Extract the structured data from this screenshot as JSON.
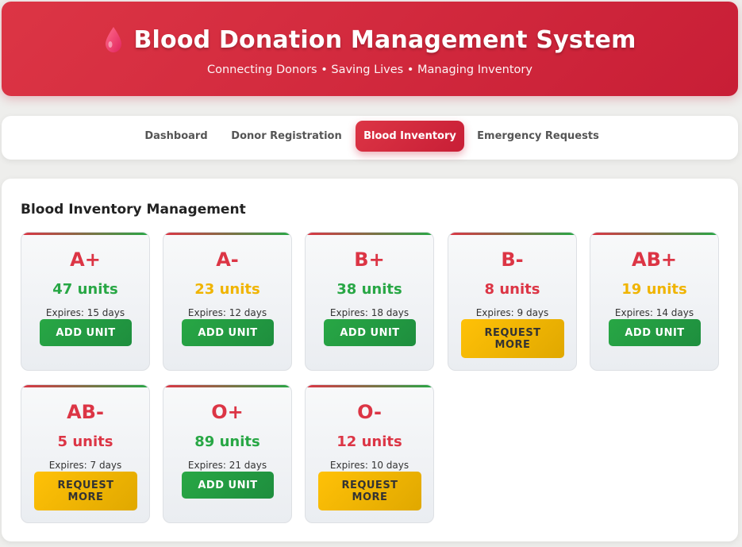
{
  "header": {
    "title": "Blood Donation Management System",
    "subtitle": "Connecting Donors • Saving Lives • Managing Inventory"
  },
  "nav": {
    "tabs": [
      {
        "label": "Dashboard",
        "active": false
      },
      {
        "label": "Donor Registration",
        "active": false
      },
      {
        "label": "Blood Inventory",
        "active": true
      },
      {
        "label": "Emergency Requests",
        "active": false
      }
    ]
  },
  "inventory": {
    "title": "Blood Inventory Management",
    "cards": [
      {
        "type": "A+",
        "units": "47 units",
        "status": "good",
        "expires": "Expires: 15 days",
        "action": "ADD UNIT",
        "action_kind": "add"
      },
      {
        "type": "A-",
        "units": "23 units",
        "status": "low",
        "expires": "Expires: 12 days",
        "action": "ADD UNIT",
        "action_kind": "add"
      },
      {
        "type": "B+",
        "units": "38 units",
        "status": "good",
        "expires": "Expires: 18 days",
        "action": "ADD UNIT",
        "action_kind": "add"
      },
      {
        "type": "B-",
        "units": "8 units",
        "status": "critical",
        "expires": "Expires: 9 days",
        "action": "REQUEST MORE",
        "action_kind": "request"
      },
      {
        "type": "AB+",
        "units": "19 units",
        "status": "low",
        "expires": "Expires: 14 days",
        "action": "ADD UNIT",
        "action_kind": "add"
      },
      {
        "type": "AB-",
        "units": "5 units",
        "status": "critical",
        "expires": "Expires: 7 days",
        "action": "REQUEST MORE",
        "action_kind": "request"
      },
      {
        "type": "O+",
        "units": "89 units",
        "status": "good",
        "expires": "Expires: 21 days",
        "action": "ADD UNIT",
        "action_kind": "add"
      },
      {
        "type": "O-",
        "units": "12 units",
        "status": "critical",
        "expires": "Expires: 10 days",
        "action": "REQUEST MORE",
        "action_kind": "request"
      }
    ]
  },
  "colors": {
    "primary": "#dc3545",
    "good": "#28a745",
    "low": "#f0b400",
    "critical": "#dc3545"
  }
}
